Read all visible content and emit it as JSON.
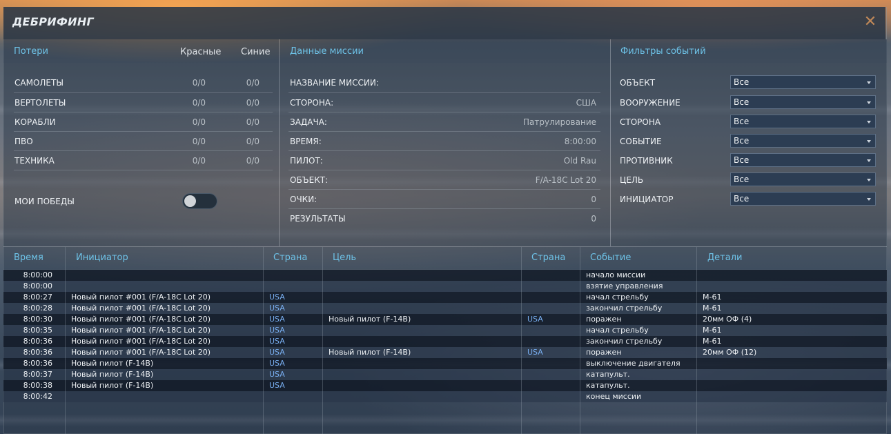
{
  "window": {
    "title": "ДЕБРИФИНГ",
    "close_glyph": "✕"
  },
  "losses": {
    "heading": "Потери",
    "col_red": "Красные",
    "col_blue": "Синие",
    "rows": [
      {
        "label": "САМОЛЕТЫ",
        "red": "0/0",
        "blue": "0/0"
      },
      {
        "label": "ВЕРТОЛЕТЫ",
        "red": "0/0",
        "blue": "0/0"
      },
      {
        "label": "КОРАБЛИ",
        "red": "0/0",
        "blue": "0/0"
      },
      {
        "label": "ПВО",
        "red": "0/0",
        "blue": "0/0"
      },
      {
        "label": "ТЕХНИКА",
        "red": "0/0",
        "blue": "0/0"
      }
    ],
    "my_wins_label": "МОИ ПОБЕДЫ",
    "my_wins_on": false
  },
  "mission": {
    "heading": "Данные миссии",
    "rows": [
      {
        "label": "НАЗВАНИЕ МИССИИ:",
        "value": ""
      },
      {
        "label": "СТОРОНА:",
        "value": "США"
      },
      {
        "label": "ЗАДАЧА:",
        "value": "Патрулирование"
      },
      {
        "label": "ВРЕМЯ:",
        "value": "8:00:00"
      },
      {
        "label": "ПИЛОТ:",
        "value": "Old Rau"
      },
      {
        "label": "ОБЪЕКТ:",
        "value": "F/A-18C Lot 20"
      },
      {
        "label": "ОЧКИ:",
        "value": "0"
      },
      {
        "label": "РЕЗУЛЬТАТЫ",
        "value": "0"
      }
    ]
  },
  "filters": {
    "heading": "Фильтры событий",
    "rows": [
      {
        "label": "ОБЪЕКТ",
        "value": "Все"
      },
      {
        "label": "ВООРУЖЕНИЕ",
        "value": "Все"
      },
      {
        "label": "СТОРОНА",
        "value": "Все"
      },
      {
        "label": "СОБЫТИЕ",
        "value": "Все"
      },
      {
        "label": "ПРОТИВНИК",
        "value": "Все"
      },
      {
        "label": "ЦЕЛЬ",
        "value": "Все"
      },
      {
        "label": "ИНИЦИАТОР",
        "value": "Все"
      }
    ]
  },
  "events": {
    "columns": [
      "Время",
      "Инициатор",
      "Страна",
      "Цель",
      "Страна",
      "Событие",
      "Детали"
    ],
    "rows": [
      {
        "time": "8:00:00",
        "initiator": "",
        "country": "",
        "target": "",
        "target_country": "",
        "event": "начало миссии",
        "details": ""
      },
      {
        "time": "8:00:00",
        "initiator": "",
        "country": "",
        "target": "",
        "target_country": "",
        "event": "взятие управления",
        "details": ""
      },
      {
        "time": "8:00:27",
        "initiator": "Новый пилот #001 (F/A-18C Lot 20)",
        "country": "USA",
        "target": "",
        "target_country": "",
        "event": "начал стрельбу",
        "details": "M-61"
      },
      {
        "time": "8:00:28",
        "initiator": "Новый пилот #001 (F/A-18C Lot 20)",
        "country": "USA",
        "target": "",
        "target_country": "",
        "event": "закончил стрельбу",
        "details": "M-61"
      },
      {
        "time": "8:00:30",
        "initiator": "Новый пилот #001 (F/A-18C Lot 20)",
        "country": "USA",
        "target": "Новый пилот (F-14B)",
        "target_country": "USA",
        "event": "поражен",
        "details": "20мм ОФ (4)"
      },
      {
        "time": "8:00:35",
        "initiator": "Новый пилот #001 (F/A-18C Lot 20)",
        "country": "USA",
        "target": "",
        "target_country": "",
        "event": "начал стрельбу",
        "details": "M-61"
      },
      {
        "time": "8:00:36",
        "initiator": "Новый пилот #001 (F/A-18C Lot 20)",
        "country": "USA",
        "target": "",
        "target_country": "",
        "event": "закончил стрельбу",
        "details": "M-61"
      },
      {
        "time": "8:00:36",
        "initiator": "Новый пилот #001 (F/A-18C Lot 20)",
        "country": "USA",
        "target": "Новый пилот (F-14B)",
        "target_country": "USA",
        "event": "поражен",
        "details": "20мм ОФ (12)"
      },
      {
        "time": "8:00:36",
        "initiator": "Новый пилот (F-14B)",
        "country": "USA",
        "target": "",
        "target_country": "",
        "event": "выключение двигателя",
        "details": ""
      },
      {
        "time": "8:00:37",
        "initiator": "Новый пилот (F-14B)",
        "country": "USA",
        "target": "",
        "target_country": "",
        "event": "катапульт.",
        "details": ""
      },
      {
        "time": "8:00:38",
        "initiator": "Новый пилот (F-14B)",
        "country": "USA",
        "target": "",
        "target_country": "",
        "event": "катапульт.",
        "details": ""
      },
      {
        "time": "8:00:42",
        "initiator": "",
        "country": "",
        "target": "",
        "target_country": "",
        "event": "конец миссии",
        "details": ""
      }
    ]
  },
  "colors": {
    "accent": "#6ec3e8",
    "link": "#78aef0",
    "close": "#c08858"
  }
}
